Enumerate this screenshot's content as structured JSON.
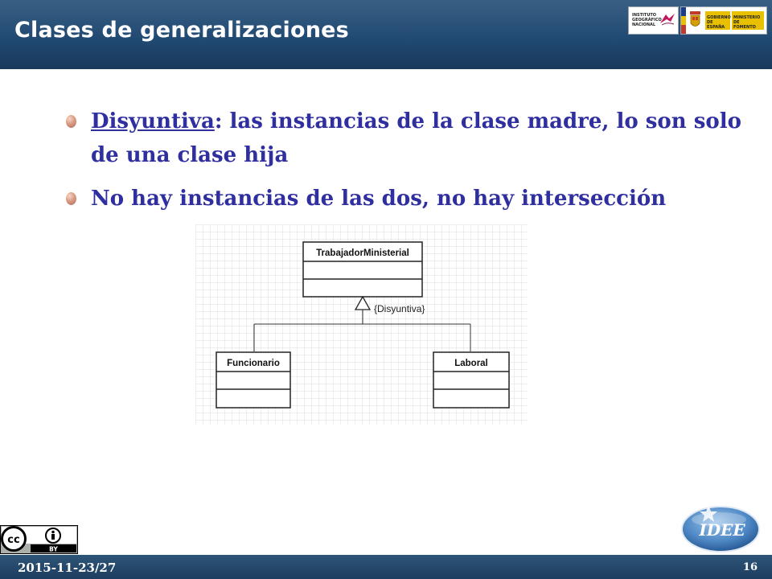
{
  "header": {
    "title": "Clases de generalizaciones",
    "logo_ign_text": "INSTITUTO GEOGRÁFICO NACIONAL",
    "logo_gov_text_1": "GOBIERNO DE ESPAÑA",
    "logo_gov_text_2": "MINISTERIO DE FOMENTO"
  },
  "bullets": [
    {
      "term": "Disyuntiva",
      "text": ": las instancias de la clase madre, lo son solo de una clase hija"
    },
    {
      "term": "",
      "text": "No hay instancias de las dos, no hay intersección"
    }
  ],
  "diagram": {
    "parent": "TrabajadorMinisterial",
    "constraint": "{Disyuntiva}",
    "children": [
      "Funcionario",
      "Laboral"
    ]
  },
  "badge": {
    "cc": "cc",
    "by": "BY"
  },
  "idee_logo_text": "IDEE",
  "footer": {
    "date": "2015-11-23/27",
    "page": "16"
  },
  "colors": {
    "header_bg": "#214a73",
    "bullet_text": "#2f2fa0",
    "footer_bg": "#1d3d5e"
  }
}
